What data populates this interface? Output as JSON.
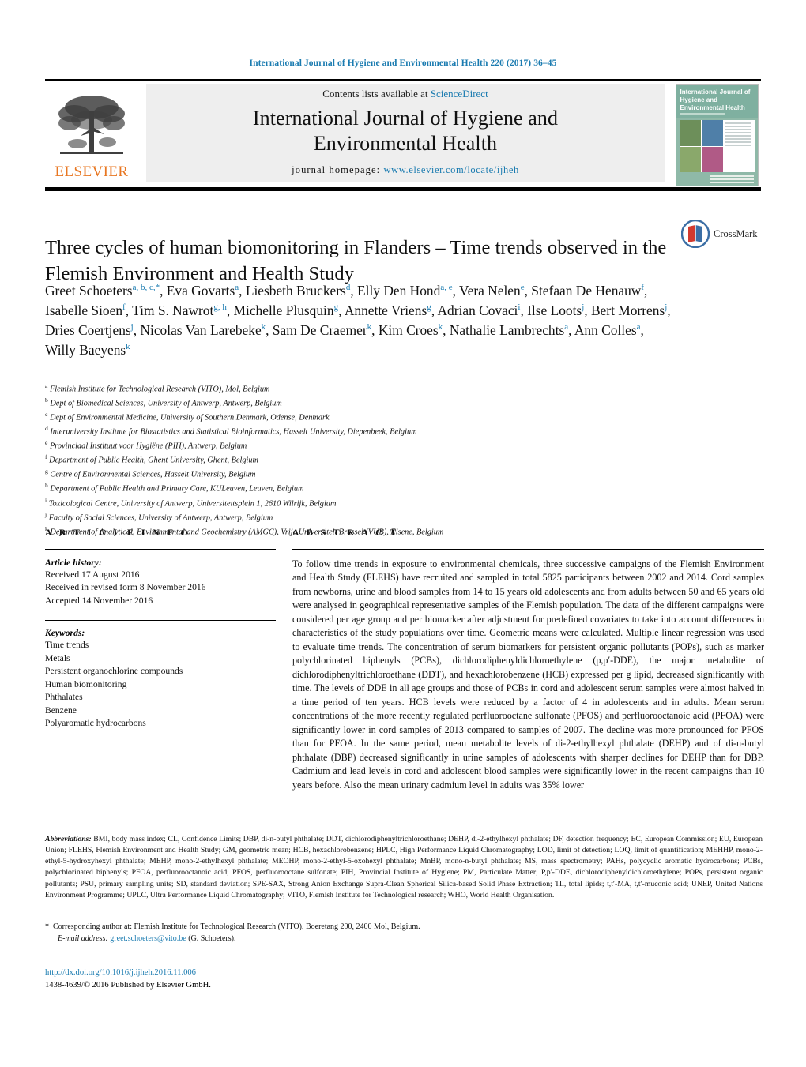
{
  "running_head": "International Journal of Hygiene and Environmental Health 220 (2017) 36–45",
  "masthead": {
    "publisher": "ELSEVIER",
    "contents_prefix": "Contents lists available at ",
    "contents_link": "ScienceDirect",
    "journal_title_line1": "International Journal of Hygiene and",
    "journal_title_line2": "Environmental Health",
    "homepage_label": "journal homepage:",
    "homepage_url": "www.elsevier.com/locate/ijheh",
    "cover_title": "International Journal of Hygiene and Environmental Health"
  },
  "crossmark": {
    "label": "CrossMark"
  },
  "title": "Three cycles of human biomonitoring in Flanders – Time trends observed in the Flemish Environment and Health Study",
  "authors_html": "Greet Schoeters<sup>a, b, c,</sup><sup class=\"star\">*</sup>, Eva Govarts<sup>a</sup>, Liesbeth Bruckers<sup>d</sup>, Elly Den Hond<sup>a, e</sup>, Vera Nelen<sup>e</sup>, Stefaan De Henauw<sup>f</sup>, Isabelle Sioen<sup>f</sup>, Tim S. Nawrot<sup>g, h</sup>, Michelle Plusquin<sup>g</sup>, Annette Vriens<sup>g</sup>, Adrian Covaci<sup>i</sup>, Ilse Loots<sup>j</sup>, Bert Morrens<sup>j</sup>, Dries Coertjens<sup>j</sup>, Nicolas Van Larebeke<sup>k</sup>, Sam De Craemer<sup>k</sup>, Kim Croes<sup>k</sup>, Nathalie Lambrechts<sup>a</sup>, Ann Colles<sup>a</sup>, Willy Baeyens<sup>k</sup>",
  "affiliations": [
    {
      "mark": "a",
      "text": "Flemish Institute for Technological Research (VITO), Mol, Belgium"
    },
    {
      "mark": "b",
      "text": "Dept of Biomedical Sciences, University of Antwerp, Antwerp, Belgium"
    },
    {
      "mark": "c",
      "text": "Dept of Environmental Medicine, University of Southern Denmark, Odense, Denmark"
    },
    {
      "mark": "d",
      "text": "Interuniversity Institute for Biostatistics and Statistical Bioinformatics, Hasselt University, Diepenbeek, Belgium"
    },
    {
      "mark": "e",
      "text": "Provinciaal Instituut voor Hygiëne (PIH), Antwerp, Belgium"
    },
    {
      "mark": "f",
      "text": "Department of Public Health, Ghent University, Ghent, Belgium"
    },
    {
      "mark": "g",
      "text": "Centre of Environmental Sciences, Hasselt University, Belgium"
    },
    {
      "mark": "h",
      "text": "Department of Public Health and Primary Care, KULeuven, Leuven, Belgium"
    },
    {
      "mark": "i",
      "text": "Toxicological Centre, University of Antwerp, Universiteitsplein 1, 2610 Wilrijk, Belgium"
    },
    {
      "mark": "j",
      "text": "Faculty of Social Sciences, University of Antwerp, Antwerp, Belgium"
    },
    {
      "mark": "k",
      "text": "Department of Analytical, Environmental and Geochemistry (AMGC), Vrije Universiteit Brussel (VUB), Elsene, Belgium"
    }
  ],
  "article_info": {
    "heading": "A R T I C L E   I N F O",
    "history_label": "Article history:",
    "history": [
      "Received 17 August 2016",
      "Received in revised form 8 November 2016",
      "Accepted 14 November 2016"
    ],
    "keywords_label": "Keywords:",
    "keywords": [
      "Time trends",
      "Metals",
      "Persistent organochlorine compounds",
      "Human biomonitoring",
      "Phthalates",
      "Benzene",
      "Polyaromatic hydrocarbons"
    ]
  },
  "abstract": {
    "heading": "A B S T R A C T",
    "text": "To follow time trends in exposure to environmental chemicals, three successive campaigns of the Flemish Environment and Health Study (FLEHS) have recruited and sampled in total 5825 participants between 2002 and 2014. Cord samples from newborns, urine and blood samples from 14 to 15 years old adolescents and from adults between 50 and 65 years old were analysed in geographical representative samples of the Flemish population. The data of the different campaigns were considered per age group and per biomarker after adjustment for predefined covariates to take into account differences in characteristics of the study populations over time. Geometric means were calculated. Multiple linear regression was used to evaluate time trends. The concentration of serum biomarkers for persistent organic pollutants (POPs), such as marker polychlorinated biphenyls (PCBs), dichlorodiphenyldichloroethylene (p,p′-DDE), the major metabolite of dichlorodiphenyltrichloroethane (DDT), and hexachlorobenzene (HCB) expressed per g lipid, decreased significantly with time. The levels of DDE in all age groups and those of PCBs in cord and adolescent serum samples were almost halved in a time period of ten years. HCB levels were reduced by a factor of 4 in adolescents and in adults. Mean serum concentrations of the more recently regulated perfluorooctane sulfonate (PFOS) and perfluorooctanoic acid (PFOA) were significantly lower in cord samples of 2013 compared to samples of 2007. The decline was more pronounced for PFOS than for PFOA. In the same period, mean metabolite levels of di-2-ethylhexyl phthalate (DEHP) and of di-n-butyl phthalate (DBP) decreased significantly in urine samples of adolescents with sharper declines for DEHP than for DBP. Cadmium and lead levels in cord and adolescent blood samples were significantly lower in the recent campaigns than 10 years before. Also the mean urinary cadmium level in adults was 35% lower"
  },
  "footnotes": {
    "abbreviations_label": "Abbreviations:",
    "abbreviations_text": "BMI, body mass index; CL, Confidence Limits; DBP, di-n-butyl phthalate; DDT, dichlorodiphenyltrichloroethane; DEHP, di-2-ethylhexyl phthalate; DF, detection frequency; EC, European Commission; EU, European Union; FLEHS, Flemish Environment and Health Study; GM, geometric mean; HCB, hexachlorobenzene; HPLC, High Performance Liquid Chromatography; LOD, limit of detection; LOQ, limit of quantification; MEHHP, mono-2-ethyl-5-hydroxyhexyl phthalate; MEHP, mono-2-ethylhexyl phthalate; MEOHP, mono-2-ethyl-5-oxohexyl phthalate; MnBP, mono-n-butyl phthalate; MS, mass spectrometry; PAHs, polycyclic aromatic hydrocarbons; PCBs, polychlorinated biphenyls; PFOA, perfluorooctanoic acid; PFOS, perfluorooctane sulfonate; PIH, Provincial Institute of Hygiene; PM, Particulate Matter; P,p′-DDE, dichlorodiphenyldichloroethylene; POPs, persistent organic pollutants; PSU, primary sampling units; SD, standard deviation; SPE-SAX, Strong Anion Exchange Supra-Clean Spherical Silica-based Solid Phase Extraction; TL, total lipids; t,t′-MA, t,t′-muconic acid; UNEP, United Nations Environment Programme; UPLC, Ultra Performance Liquid Chromatography; VITO, Flemish Institute for Technological research; WHO, World Health Organisation.",
    "corresponding_star": "*",
    "corresponding_text": "Corresponding author at: Flemish Institute for Technological Research (VITO), Boeretang 200, 2400 Mol, Belgium.",
    "email_label": "E-mail address:",
    "email_link": "greet.schoeters@vito.be",
    "email_suffix": "(G. Schoeters).",
    "doi_url": "http://dx.doi.org/10.1016/j.ijheh.2016.11.006",
    "copyright": "1438-4639/© 2016 Published by Elsevier GmbH."
  }
}
